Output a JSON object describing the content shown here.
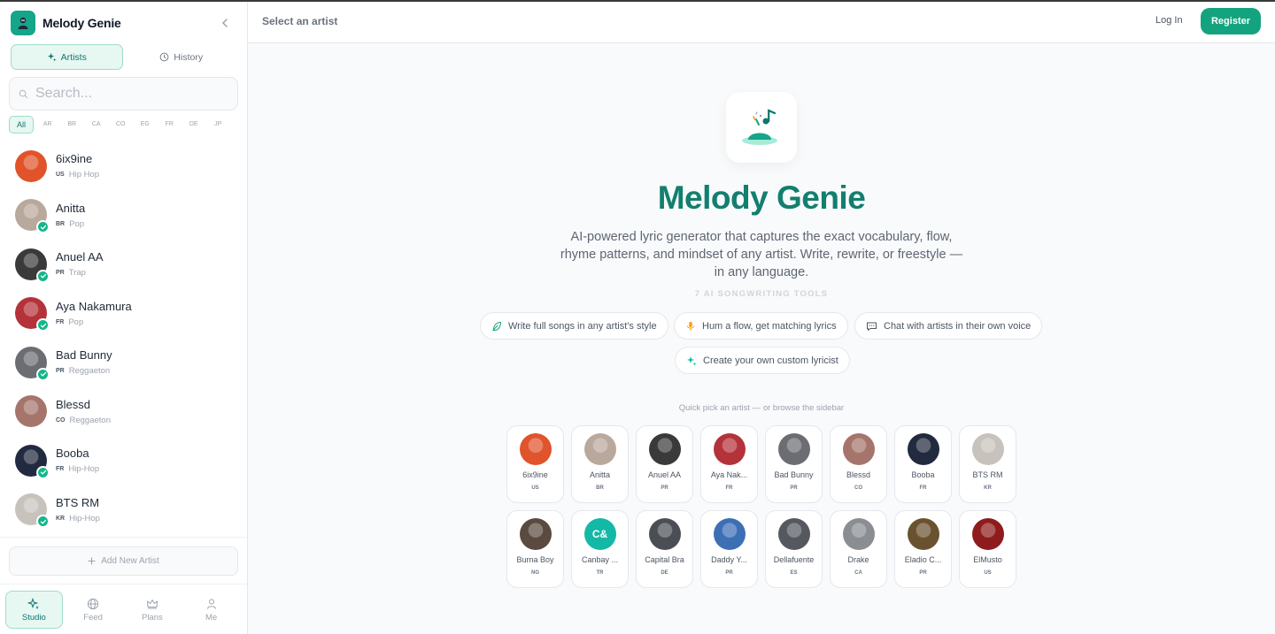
{
  "app": {
    "name": "Melody Genie"
  },
  "sidebar": {
    "tabs": [
      {
        "label": "Artists",
        "icon": "sparkles-icon"
      },
      {
        "label": "History",
        "icon": "clock-icon"
      }
    ],
    "search_placeholder": "Search...",
    "filters": [
      "All",
      "AR",
      "BR",
      "CA",
      "CO",
      "EG",
      "FR",
      "DE",
      "JP"
    ],
    "artists": [
      {
        "name": "6ix9ine",
        "country": "US",
        "genre": "Hip Hop",
        "color": "#e0532b"
      },
      {
        "name": "Anitta",
        "country": "BR",
        "genre": "Pop",
        "color": "#b9a89c"
      },
      {
        "name": "Anuel AA",
        "country": "PR",
        "genre": "Trap",
        "color": "#3a3a3a"
      },
      {
        "name": "Aya Nakamura",
        "country": "FR",
        "genre": "Pop",
        "color": "#b4323a"
      },
      {
        "name": "Bad Bunny",
        "country": "PR",
        "genre": "Reggaeton",
        "color": "#6b6d73"
      },
      {
        "name": "Blessd",
        "country": "CO",
        "genre": "Reggaeton",
        "color": "#a5756b"
      },
      {
        "name": "Booba",
        "country": "FR",
        "genre": "Hip-Hop",
        "color": "#222a3f"
      },
      {
        "name": "BTS RM",
        "country": "KR",
        "genre": "Hip-Hop",
        "color": "#c8c2bc"
      }
    ],
    "add_artist_label": "Add New Artist",
    "bottom_nav": [
      {
        "label": "Studio",
        "icon": "sparkles-icon"
      },
      {
        "label": "Feed",
        "icon": "globe-icon"
      },
      {
        "label": "Plans",
        "icon": "crown-icon"
      },
      {
        "label": "Me",
        "icon": "user-icon"
      }
    ]
  },
  "header": {
    "title": "Select an artist",
    "login_label": "Log In",
    "register_label": "Register"
  },
  "hero": {
    "title": "Melody Genie",
    "description": "AI-powered lyric generator that captures the exact vocabulary, flow, rhyme patterns, and mindset of any artist. Write, rewrite, or freestyle — in any language.",
    "tools_label": "7 AI SONGWRITING TOOLS",
    "chips": [
      {
        "label": "Write full songs in any artist's style",
        "icon": "feather-icon"
      },
      {
        "label": "Hum a flow, get matching lyrics",
        "icon": "microphone-icon"
      },
      {
        "label": "Chat with artists in their own voice",
        "icon": "chat-bubble-icon"
      },
      {
        "label": "Create your own custom lyricist",
        "icon": "sparkles-icon"
      }
    ],
    "quick_pick_label": "Quick pick an artist — or browse the sidebar"
  },
  "quick_pick": [
    {
      "name": "6ix9ine",
      "country": "US",
      "color": "#e0532b"
    },
    {
      "name": "Anitta",
      "country": "BR",
      "color": "#b9a89c"
    },
    {
      "name": "Anuel AA",
      "country": "PR",
      "color": "#3a3a3a"
    },
    {
      "name": "Aya Nak...",
      "country": "FR",
      "color": "#b4323a"
    },
    {
      "name": "Bad Bunny",
      "country": "PR",
      "color": "#6b6d73"
    },
    {
      "name": "Blessd",
      "country": "CO",
      "color": "#a5756b"
    },
    {
      "name": "Booba",
      "country": "FR",
      "color": "#222a3f"
    },
    {
      "name": "BTS RM",
      "country": "KR",
      "color": "#c8c2bc"
    },
    {
      "name": "Burna Boy",
      "country": "NG",
      "color": "#5a4a40"
    },
    {
      "name": "Canbay ...",
      "country": "TR",
      "color": "#14b8a6",
      "initials": "C&"
    },
    {
      "name": "Capital Bra",
      "country": "DE",
      "color": "#4b4f55"
    },
    {
      "name": "Daddy Y...",
      "country": "PR",
      "color": "#3d6fb5"
    },
    {
      "name": "Dellafuente",
      "country": "ES",
      "color": "#55585e"
    },
    {
      "name": "Drake",
      "country": "CA",
      "color": "#8a8d92"
    },
    {
      "name": "Eladio C...",
      "country": "PR",
      "color": "#6a5230"
    },
    {
      "name": "ElMusto",
      "country": "US",
      "color": "#8e1c1c"
    }
  ],
  "colors": {
    "accent": "#14a37f",
    "title": "#127f6f"
  }
}
